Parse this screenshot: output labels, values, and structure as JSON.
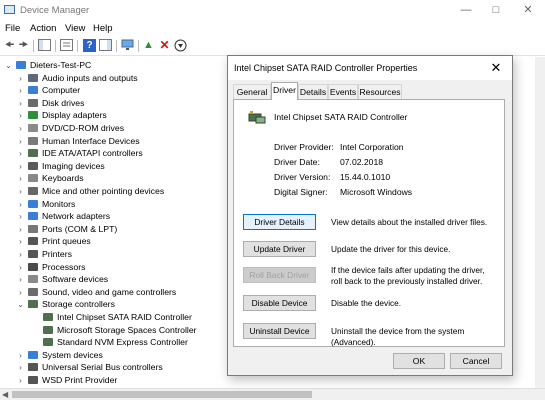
{
  "window": {
    "title": "Device Manager"
  },
  "menu": [
    "File",
    "Action",
    "View",
    "Help"
  ],
  "tree": {
    "root": "Dieters-Test-PC",
    "items": [
      {
        "label": "Audio inputs and outputs",
        "expander": "›",
        "icon_color": "#5c6b7a"
      },
      {
        "label": "Computer",
        "expander": "›",
        "icon_color": "#3a7fd5"
      },
      {
        "label": "Disk drives",
        "expander": "›",
        "icon_color": "#6b6b6b"
      },
      {
        "label": "Display adapters",
        "expander": "›",
        "icon_color": "#2f8f3a"
      },
      {
        "label": "DVD/CD-ROM drives",
        "expander": "›",
        "icon_color": "#8a8a8a"
      },
      {
        "label": "Human Interface Devices",
        "expander": "›",
        "icon_color": "#7a7a7a"
      },
      {
        "label": "IDE ATA/ATAPI controllers",
        "expander": "›",
        "icon_color": "#4f6f4f"
      },
      {
        "label": "Imaging devices",
        "expander": "›",
        "icon_color": "#5a5a5a"
      },
      {
        "label": "Keyboards",
        "expander": "›",
        "icon_color": "#888888"
      },
      {
        "label": "Mice and other pointing devices",
        "expander": "›",
        "icon_color": "#666666"
      },
      {
        "label": "Monitors",
        "expander": "›",
        "icon_color": "#3a7fd5"
      },
      {
        "label": "Network adapters",
        "expander": "›",
        "icon_color": "#3a7fd5"
      },
      {
        "label": "Ports (COM & LPT)",
        "expander": "›",
        "icon_color": "#777777"
      },
      {
        "label": "Print queues",
        "expander": "›",
        "icon_color": "#555555"
      },
      {
        "label": "Printers",
        "expander": "›",
        "icon_color": "#555555"
      },
      {
        "label": "Processors",
        "expander": "›",
        "icon_color": "#4a4a4a"
      },
      {
        "label": "Software devices",
        "expander": "›",
        "icon_color": "#8a8a8a"
      },
      {
        "label": "Sound, video and game controllers",
        "expander": "›",
        "icon_color": "#6b6b6b"
      },
      {
        "label": "Storage controllers",
        "expander": "⌄",
        "icon_color": "#4f6f4f"
      },
      {
        "label": "Intel Chipset SATA RAID Controller",
        "expander": "",
        "icon_color": "#4f6f4f",
        "child": true
      },
      {
        "label": "Microsoft Storage Spaces Controller",
        "expander": "",
        "icon_color": "#4f6f4f",
        "child": true
      },
      {
        "label": "Standard NVM Express Controller",
        "expander": "",
        "icon_color": "#4f6f4f",
        "child": true
      },
      {
        "label": "System devices",
        "expander": "›",
        "icon_color": "#3a7fd5"
      },
      {
        "label": "Universal Serial Bus controllers",
        "expander": "›",
        "icon_color": "#555555"
      },
      {
        "label": "WSD Print Provider",
        "expander": "›",
        "icon_color": "#555555"
      }
    ]
  },
  "dialog": {
    "title": "Intel Chipset SATA RAID Controller Properties",
    "tabs": [
      "General",
      "Driver",
      "Details",
      "Events",
      "Resources"
    ],
    "active_tab": "Driver",
    "device_name": "Intel Chipset SATA RAID Controller",
    "info": [
      {
        "label": "Driver Provider:",
        "value": "Intel Corporation"
      },
      {
        "label": "Driver Date:",
        "value": "07.02.2018"
      },
      {
        "label": "Driver Version:",
        "value": "15.44.0.1010"
      },
      {
        "label": "Digital Signer:",
        "value": "Microsoft Windows"
      }
    ],
    "buttons": [
      {
        "label": "Driver Details",
        "desc": "View details about the installed driver files."
      },
      {
        "label": "Update Driver",
        "desc": "Update the driver for this device."
      },
      {
        "label": "Roll Back Driver",
        "desc": "If the device fails after updating the driver, roll back to the previously installed driver."
      },
      {
        "label": "Disable Device",
        "desc": "Disable the device."
      },
      {
        "label": "Uninstall Device",
        "desc": "Uninstall the device from the system (Advanced)."
      }
    ],
    "ok": "OK",
    "cancel": "Cancel"
  }
}
